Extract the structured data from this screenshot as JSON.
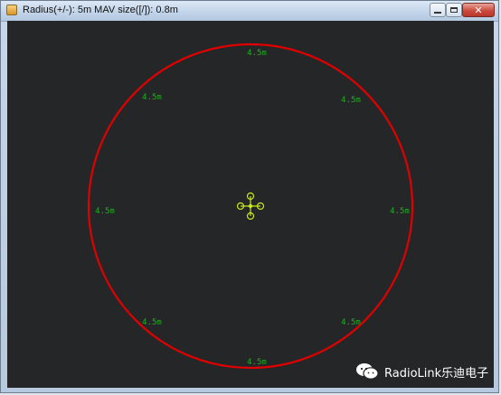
{
  "window": {
    "title": "Radius(+/-): 5m MAV size([/]): 0.8m",
    "controls": {
      "minimize_icon": "minimize-icon",
      "maximize_icon": "maximize-icon",
      "close_icon": "close-icon"
    }
  },
  "radar": {
    "circle_color": "#e00000",
    "label_color": "#20b020",
    "vehicle_color": "#c8e820",
    "background": "#252628",
    "sector_labels": [
      {
        "direction": "N",
        "text": "4.5m"
      },
      {
        "direction": "NE",
        "text": "4.5m"
      },
      {
        "direction": "E",
        "text": "4.5m"
      },
      {
        "direction": "SE",
        "text": "4.5m"
      },
      {
        "direction": "S",
        "text": "4.5m"
      },
      {
        "direction": "SW",
        "text": "4.5m"
      },
      {
        "direction": "W",
        "text": "4.5m"
      },
      {
        "direction": "NW",
        "text": "4.5m"
      }
    ]
  },
  "watermark": {
    "icon": "wechat-icon",
    "text": "RadioLink乐迪电子"
  }
}
